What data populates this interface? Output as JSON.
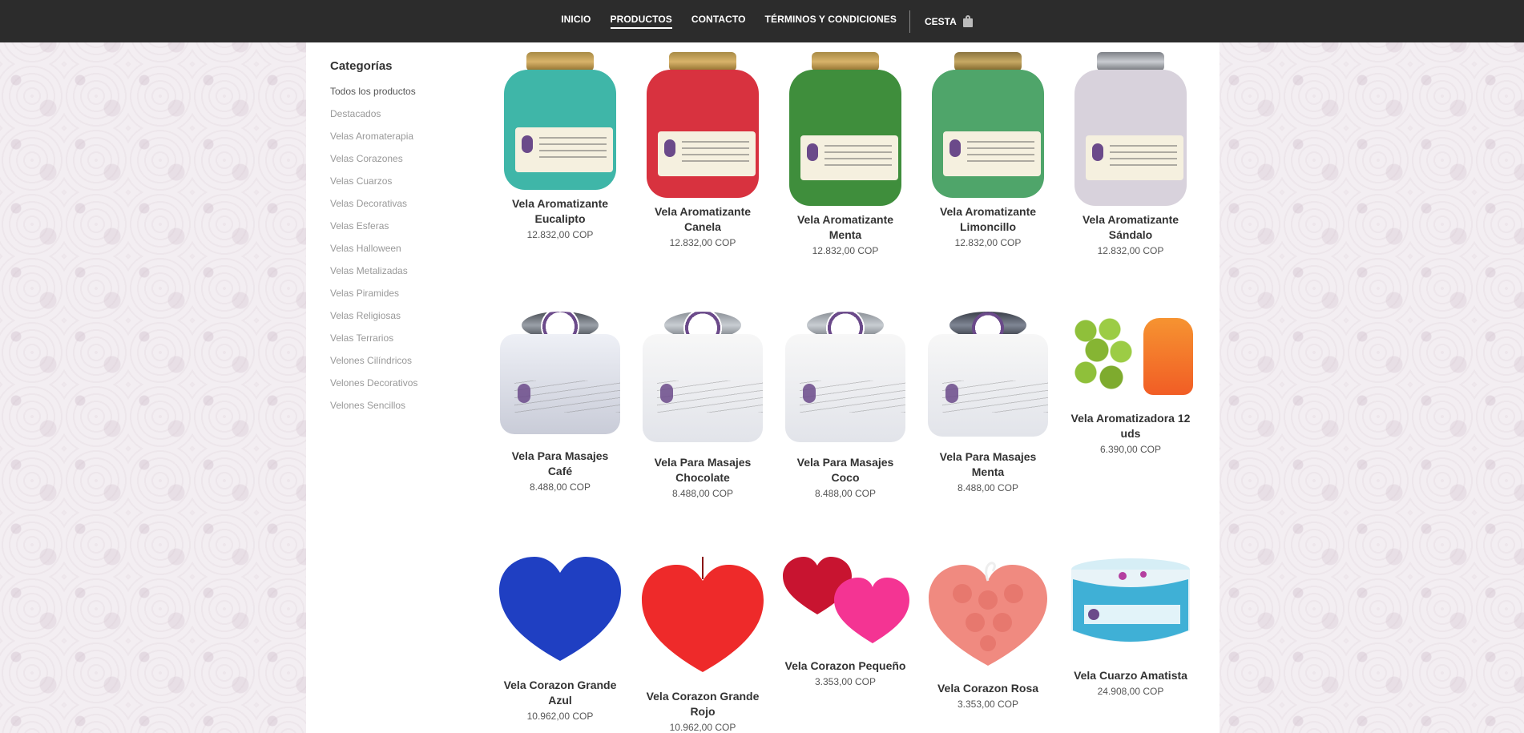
{
  "nav": {
    "items": [
      {
        "label": "INICIO",
        "active": false
      },
      {
        "label": "PRODUCTOS",
        "active": true
      },
      {
        "label": "CONTACTO",
        "active": false
      },
      {
        "label": "TÉRMINOS Y CONDICIONES",
        "active": false
      }
    ],
    "cart_label": "CESTA",
    "cart_icon": "bag-icon"
  },
  "sidebar": {
    "title": "Categorías",
    "items": [
      "Todos los productos",
      "Destacados",
      "Velas Aromaterapia",
      "Velas Corazones",
      "Velas Cuarzos",
      "Velas Decorativas",
      "Velas Esferas",
      "Velas Halloween",
      "Velas Metalizadas",
      "Velas Piramides",
      "Velas Religiosas",
      "Velas Terrarios",
      "Velones Cilíndricos",
      "Velones Decorativos",
      "Velones Sencillos"
    ]
  },
  "products": [
    {
      "name": "Vela Aromatizante Eucalipto",
      "price": "12.832,00 COP",
      "color": "#3fb6a8"
    },
    {
      "name": "Vela Aromatizante Canela",
      "price": "12.832,00 COP",
      "color": "#d8323f"
    },
    {
      "name": "Vela Aromatizante Menta",
      "price": "12.832,00 COP",
      "color": "#3f8e3c"
    },
    {
      "name": "Vela Aromatizante Limoncillo",
      "price": "12.832,00 COP",
      "color": "#4fa56a"
    },
    {
      "name": "Vela Aromatizante Sándalo",
      "price": "12.832,00 COP",
      "color": "#d8d2dc"
    },
    {
      "name": "Vela Para Masajes Café",
      "price": "8.488,00 COP",
      "color": "#e6e9f1"
    },
    {
      "name": "Vela Para Masajes Chocolate",
      "price": "8.488,00 COP",
      "color": "#f2f3f5"
    },
    {
      "name": "Vela Para Masajes Coco",
      "price": "8.488,00 COP",
      "color": "#eeeff2"
    },
    {
      "name": "Vela Para Masajes Menta",
      "price": "8.488,00 COP",
      "color": "#eef0f3"
    },
    {
      "name": "Vela Aromatizadora 12 uds",
      "price": "6.390,00 COP",
      "color": "#8fc03a"
    },
    {
      "name": "Vela Corazon Grande Azul",
      "price": "10.962,00 COP",
      "color": "#1f3fc2"
    },
    {
      "name": "Vela Corazon Grande Rojo",
      "price": "10.962,00 COP",
      "color": "#ee2a2a"
    },
    {
      "name": "Vela Corazon Pequeño",
      "price": "3.353,00 COP",
      "color": "#e31d5a"
    },
    {
      "name": "Vela Corazon Rosa",
      "price": "3.353,00 COP",
      "color": "#f08a80"
    },
    {
      "name": "Vela Cuarzo Amatista",
      "price": "24.908,00 COP",
      "color": "#3fb0d6"
    }
  ]
}
